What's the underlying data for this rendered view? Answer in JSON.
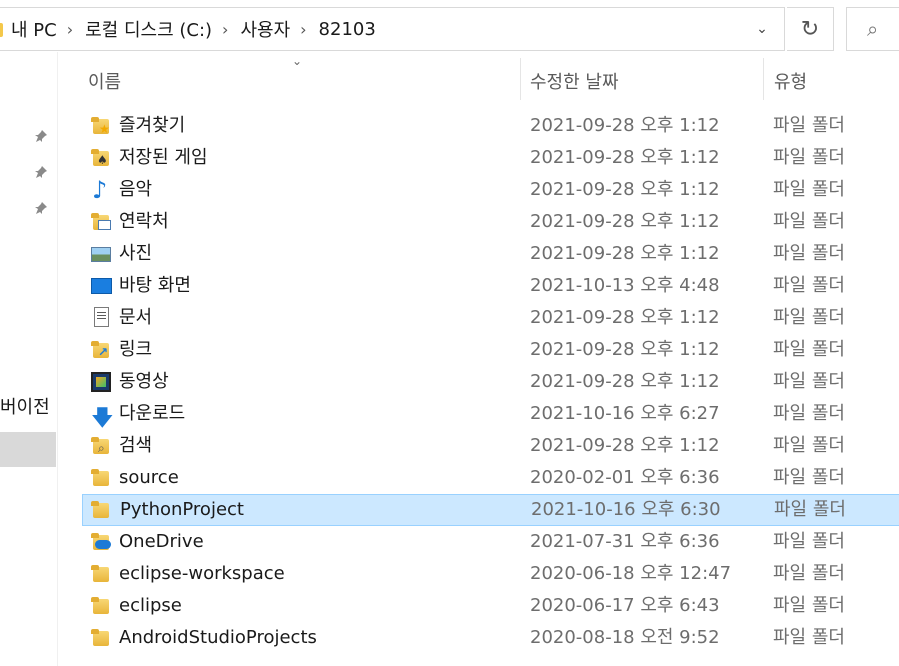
{
  "address": {
    "crumbs": [
      "내 PC",
      "로컬 디스크 (C:)",
      "사용자",
      "82103"
    ],
    "separator": "›",
    "dropdown_glyph": "⌄",
    "refresh_glyph": "↻",
    "search_glyph": "⌕"
  },
  "nav": {
    "partial_label": "버이전"
  },
  "columns": {
    "name": "이름",
    "date": "수정한 날짜",
    "type": "유형"
  },
  "rows": [
    {
      "name": "즐겨찾기",
      "date": "2021-09-28 오후 1:12",
      "type": "파일 폴더",
      "icon": "favorites-folder-icon"
    },
    {
      "name": "저장된 게임",
      "date": "2021-09-28 오후 1:12",
      "type": "파일 폴더",
      "icon": "saved-games-folder-icon"
    },
    {
      "name": "음악",
      "date": "2021-09-28 오후 1:12",
      "type": "파일 폴더",
      "icon": "music-icon"
    },
    {
      "name": "연락처",
      "date": "2021-09-28 오후 1:12",
      "type": "파일 폴더",
      "icon": "contacts-folder-icon"
    },
    {
      "name": "사진",
      "date": "2021-09-28 오후 1:12",
      "type": "파일 폴더",
      "icon": "pictures-icon"
    },
    {
      "name": "바탕 화면",
      "date": "2021-10-13 오후 4:48",
      "type": "파일 폴더",
      "icon": "desktop-icon"
    },
    {
      "name": "문서",
      "date": "2021-09-28 오후 1:12",
      "type": "파일 폴더",
      "icon": "documents-icon"
    },
    {
      "name": "링크",
      "date": "2021-09-28 오후 1:12",
      "type": "파일 폴더",
      "icon": "links-folder-icon"
    },
    {
      "name": "동영상",
      "date": "2021-09-28 오후 1:12",
      "type": "파일 폴더",
      "icon": "videos-icon"
    },
    {
      "name": "다운로드",
      "date": "2021-10-16 오후 6:27",
      "type": "파일 폴더",
      "icon": "downloads-icon"
    },
    {
      "name": "검색",
      "date": "2021-09-28 오후 1:12",
      "type": "파일 폴더",
      "icon": "searches-folder-icon"
    },
    {
      "name": "source",
      "date": "2020-02-01 오후 6:36",
      "type": "파일 폴더",
      "icon": "folder-icon"
    },
    {
      "name": "PythonProject",
      "date": "2021-10-16 오후 6:30",
      "type": "파일 폴더",
      "icon": "folder-icon",
      "selected": true
    },
    {
      "name": "OneDrive",
      "date": "2021-07-31 오후 6:36",
      "type": "파일 폴더",
      "icon": "onedrive-folder-icon"
    },
    {
      "name": "eclipse-workspace",
      "date": "2020-06-18 오후 12:47",
      "type": "파일 폴더",
      "icon": "folder-icon"
    },
    {
      "name": "eclipse",
      "date": "2020-06-17 오후 6:43",
      "type": "파일 폴더",
      "icon": "folder-icon"
    },
    {
      "name": "AndroidStudioProjects",
      "date": "2020-08-18 오전 9:52",
      "type": "파일 폴더",
      "icon": "folder-icon"
    }
  ]
}
